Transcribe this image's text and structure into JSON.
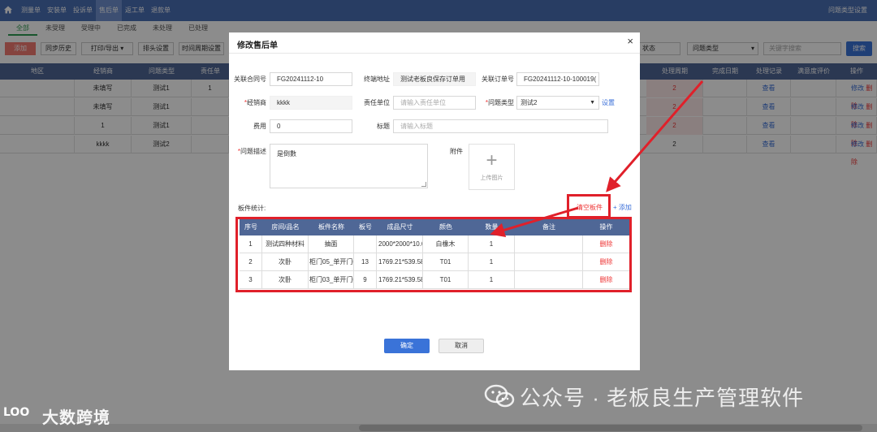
{
  "topnav": {
    "items": [
      {
        "label": "测量单",
        "active": false
      },
      {
        "label": "安装单",
        "active": false
      },
      {
        "label": "投诉单",
        "active": false
      },
      {
        "label": "售后单",
        "active": true
      },
      {
        "label": "返工单",
        "active": false
      },
      {
        "label": "退款单",
        "active": false
      }
    ],
    "right_label": "问题类型设置"
  },
  "subtabs": [
    "全部",
    "未受理",
    "受理中",
    "已完成",
    "未处理",
    "已处理"
  ],
  "toolbar": {
    "add": "添加",
    "sync_history": "同步历史",
    "print_export": "打印/导出",
    "column_settings": "排头设置",
    "time_settings": "时间周期设置",
    "status_select": "状态",
    "issue_type_select": "问题类型",
    "search_placeholder": "关键字搜索",
    "search_button": "搜索"
  },
  "bg_table": {
    "headers_left": [
      "地区",
      "经销商",
      "问题类型",
      "责任单"
    ],
    "headers_right": [
      "处理周期",
      "完成日期",
      "处理记录",
      "满意度评价",
      "操作"
    ],
    "rows": [
      {
        "dealer": "未填写",
        "type": "测试1",
        "resp": "1",
        "cycle": "2",
        "record": "查看",
        "edit": "修改",
        "delete": "删除",
        "highlight": true
      },
      {
        "dealer": "未填写",
        "type": "测试1",
        "resp": "",
        "cycle": "2",
        "record": "查看",
        "edit": "修改",
        "delete": "删除",
        "highlight": true
      },
      {
        "dealer": "1",
        "type": "测试1",
        "resp": "",
        "cycle": "2",
        "record": "查看",
        "edit": "修改",
        "delete": "删除",
        "highlight": true
      },
      {
        "dealer": "kkkk",
        "type": "测试2",
        "resp": "",
        "cycle": "2",
        "record": "查看",
        "edit": "修改",
        "delete": "删除",
        "highlight": false
      }
    ]
  },
  "modal": {
    "title": "修改售后单",
    "close": "×",
    "fields": {
      "contract_label": "关联合同号",
      "contract_value": "FG20241112-10",
      "address_label": "终端地址",
      "address_value": "测试老板良保存订单用",
      "order_label": "关联订单号",
      "order_value": "FG20241112-10-100019(",
      "dealer_label": "经销商",
      "dealer_value": "kkkk",
      "resp_unit_label": "责任单位",
      "resp_unit_placeholder": "请输入责任单位",
      "issue_type_label": "问题类型",
      "issue_type_value": "测试2",
      "settings_link": "设置",
      "fee_label": "费用",
      "fee_value": "0",
      "title_label": "标题",
      "title_placeholder": "请输入标题",
      "desc_label": "问题描述",
      "desc_value": "是倒數",
      "attach_label": "附件",
      "upload_text": "上传图片",
      "req_mark": "*"
    },
    "board_stats_label": "板件统计:",
    "clear_boards": "清空板件",
    "add_link": "+ 添加",
    "board_table": {
      "headers": [
        "序号",
        "房间/品名",
        "板件名称",
        "板号",
        "成品尺寸",
        "颜色",
        "数量",
        "备注",
        "操作"
      ],
      "rows": [
        {
          "no": "1",
          "room": "测试四种材料",
          "name": "抽面",
          "board_no": "",
          "size": "2000*2000*10.0",
          "color": "白橡木",
          "qty": "1",
          "note": "",
          "op": "删除"
        },
        {
          "no": "2",
          "room": "次卧",
          "name": "柜门05_单开门0",
          "board_no": "13",
          "size": "1769.21*539.58",
          "color": "T01",
          "qty": "1",
          "note": "",
          "op": "删除"
        },
        {
          "no": "3",
          "room": "次卧",
          "name": "柜门03_单开门0",
          "board_no": "9",
          "size": "1769.21*539.58",
          "color": "T01",
          "qty": "1",
          "note": "",
          "op": "删除"
        }
      ]
    },
    "ok": "确定",
    "cancel": "取消"
  },
  "watermark": {
    "left_logo": "LOO",
    "left_text": "大数跨境",
    "right_text": "公众号 · 老板良生产管理软件"
  },
  "colors": {
    "nav": "#4a6fb5",
    "header": "#4f6796",
    "primary": "#3a73d8",
    "danger": "#e33333",
    "annotation": "#e0202a",
    "success": "#2f9c52"
  }
}
